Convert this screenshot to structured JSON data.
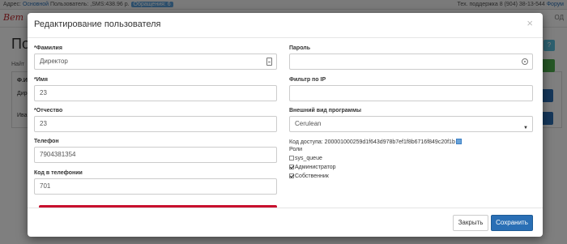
{
  "background": {
    "topbar": {
      "address_label": "Адрес:",
      "address_link": "Основной",
      "user_text": "Пользователь: ,SMS:438.96 р.",
      "requests_badge": "Обращения: 6",
      "support": "Тех. поддержка 8 (904) 38-13-544",
      "forum": "Форум"
    },
    "brand": "Вет",
    "nav_right": "ОД",
    "page_title": "Пол",
    "find_label": "Найт",
    "table_header": "Ф.И.",
    "row1": "Дире",
    "row2": "Иван"
  },
  "modal": {
    "title": "Редактирование пользователя",
    "close_symbol": "×",
    "left_fields": [
      {
        "label": "*Фамилия",
        "value": "Директор"
      },
      {
        "label": "*Имя",
        "value": "23"
      },
      {
        "label": "*Отчество",
        "value": "23"
      },
      {
        "label": "Телефон",
        "value": "7904381354"
      },
      {
        "label": "Код в телефонии",
        "value": "701"
      }
    ],
    "right": {
      "password_label": "Пароль",
      "password_value": "",
      "ip_filter_label": "Фильтр по IP",
      "ip_filter_value": "",
      "theme_label": "Внешний вид программы",
      "theme_value": "Cerulean",
      "access_code": "Код доступа: 200001000259d1f643d978b7ef1f8b6716f849c20f1b",
      "roles_label": "Роли",
      "roles": [
        {
          "name": "sys_queue",
          "checked": false
        },
        {
          "name": "Администратор",
          "checked": true
        },
        {
          "name": "Собственник",
          "checked": true
        }
      ]
    },
    "footer": {
      "close_label": "Закрыть",
      "save_label": "Сохранить"
    }
  },
  "colors": {
    "primary": "#2a6fb5",
    "danger_line": "#c8102e",
    "brand": "#c0292f"
  }
}
